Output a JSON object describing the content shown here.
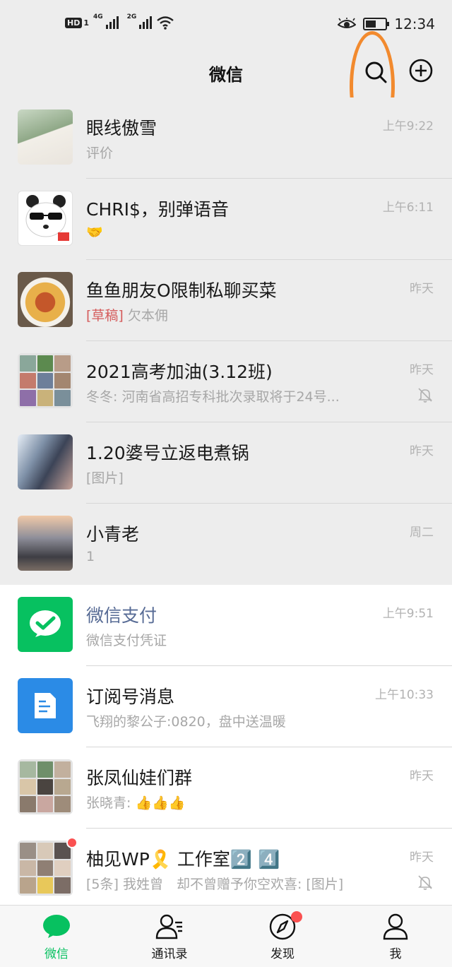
{
  "status_bar": {
    "hd_label": "HD",
    "sim1": "1",
    "net1": "4G",
    "net2": "2G",
    "time": "12:34"
  },
  "header": {
    "title": "微信",
    "search_icon": "search-icon",
    "add_icon": "plus-circle-icon"
  },
  "chats": [
    {
      "name": "眼线傲雪",
      "preview": "评价",
      "time": "上午9:22",
      "muted": false
    },
    {
      "name": "CHRI$，别弹语音",
      "preview": "🤝",
      "time": "上午6:11",
      "muted": false
    },
    {
      "name": "鱼鱼朋友O限制私聊买菜",
      "draft_tag": "[草稿]",
      "preview": "欠本佣",
      "time": "昨天",
      "muted": false
    },
    {
      "name": "2021高考加油(3.12班)",
      "preview": "冬冬: 河南省高招专科批次录取将于24号...",
      "time": "昨天",
      "muted": true
    },
    {
      "name": "1.20婆号立返电煮锅",
      "preview": "[图片]",
      "time": "昨天",
      "muted": false
    },
    {
      "name": "小青老",
      "preview": "1",
      "time": "周二",
      "muted": false
    },
    {
      "name": "微信支付",
      "preview": "微信支付凭证",
      "time": "上午9:51",
      "muted": false
    },
    {
      "name": "订阅号消息",
      "preview": "飞翔的黎公子:0820，盘中送温暖",
      "time": "上午10:33",
      "muted": false
    },
    {
      "name": "张凤仙娃们群",
      "preview": "张晓青: 👍👍👍",
      "time": "昨天",
      "muted": false
    },
    {
      "name": "柚见WP🎗️ 工作室2️⃣ 4️⃣",
      "preview": "[5条] 我姓曾　却不曾赠予你空欢喜: [图片]",
      "time": "昨天",
      "muted": true,
      "unread_dot": true
    }
  ],
  "tabs": [
    {
      "label": "微信",
      "icon": "chat-bubble-icon",
      "active": true
    },
    {
      "label": "通讯录",
      "icon": "contacts-icon",
      "active": false
    },
    {
      "label": "发现",
      "icon": "compass-icon",
      "active": false,
      "dot": true
    },
    {
      "label": "我",
      "icon": "person-icon",
      "active": false
    }
  ],
  "colors": {
    "brand_green": "#07c160",
    "background": "#ededed",
    "annotation_orange": "#f28a2e",
    "badge_red": "#fa5151",
    "service_name": "#576b95"
  }
}
